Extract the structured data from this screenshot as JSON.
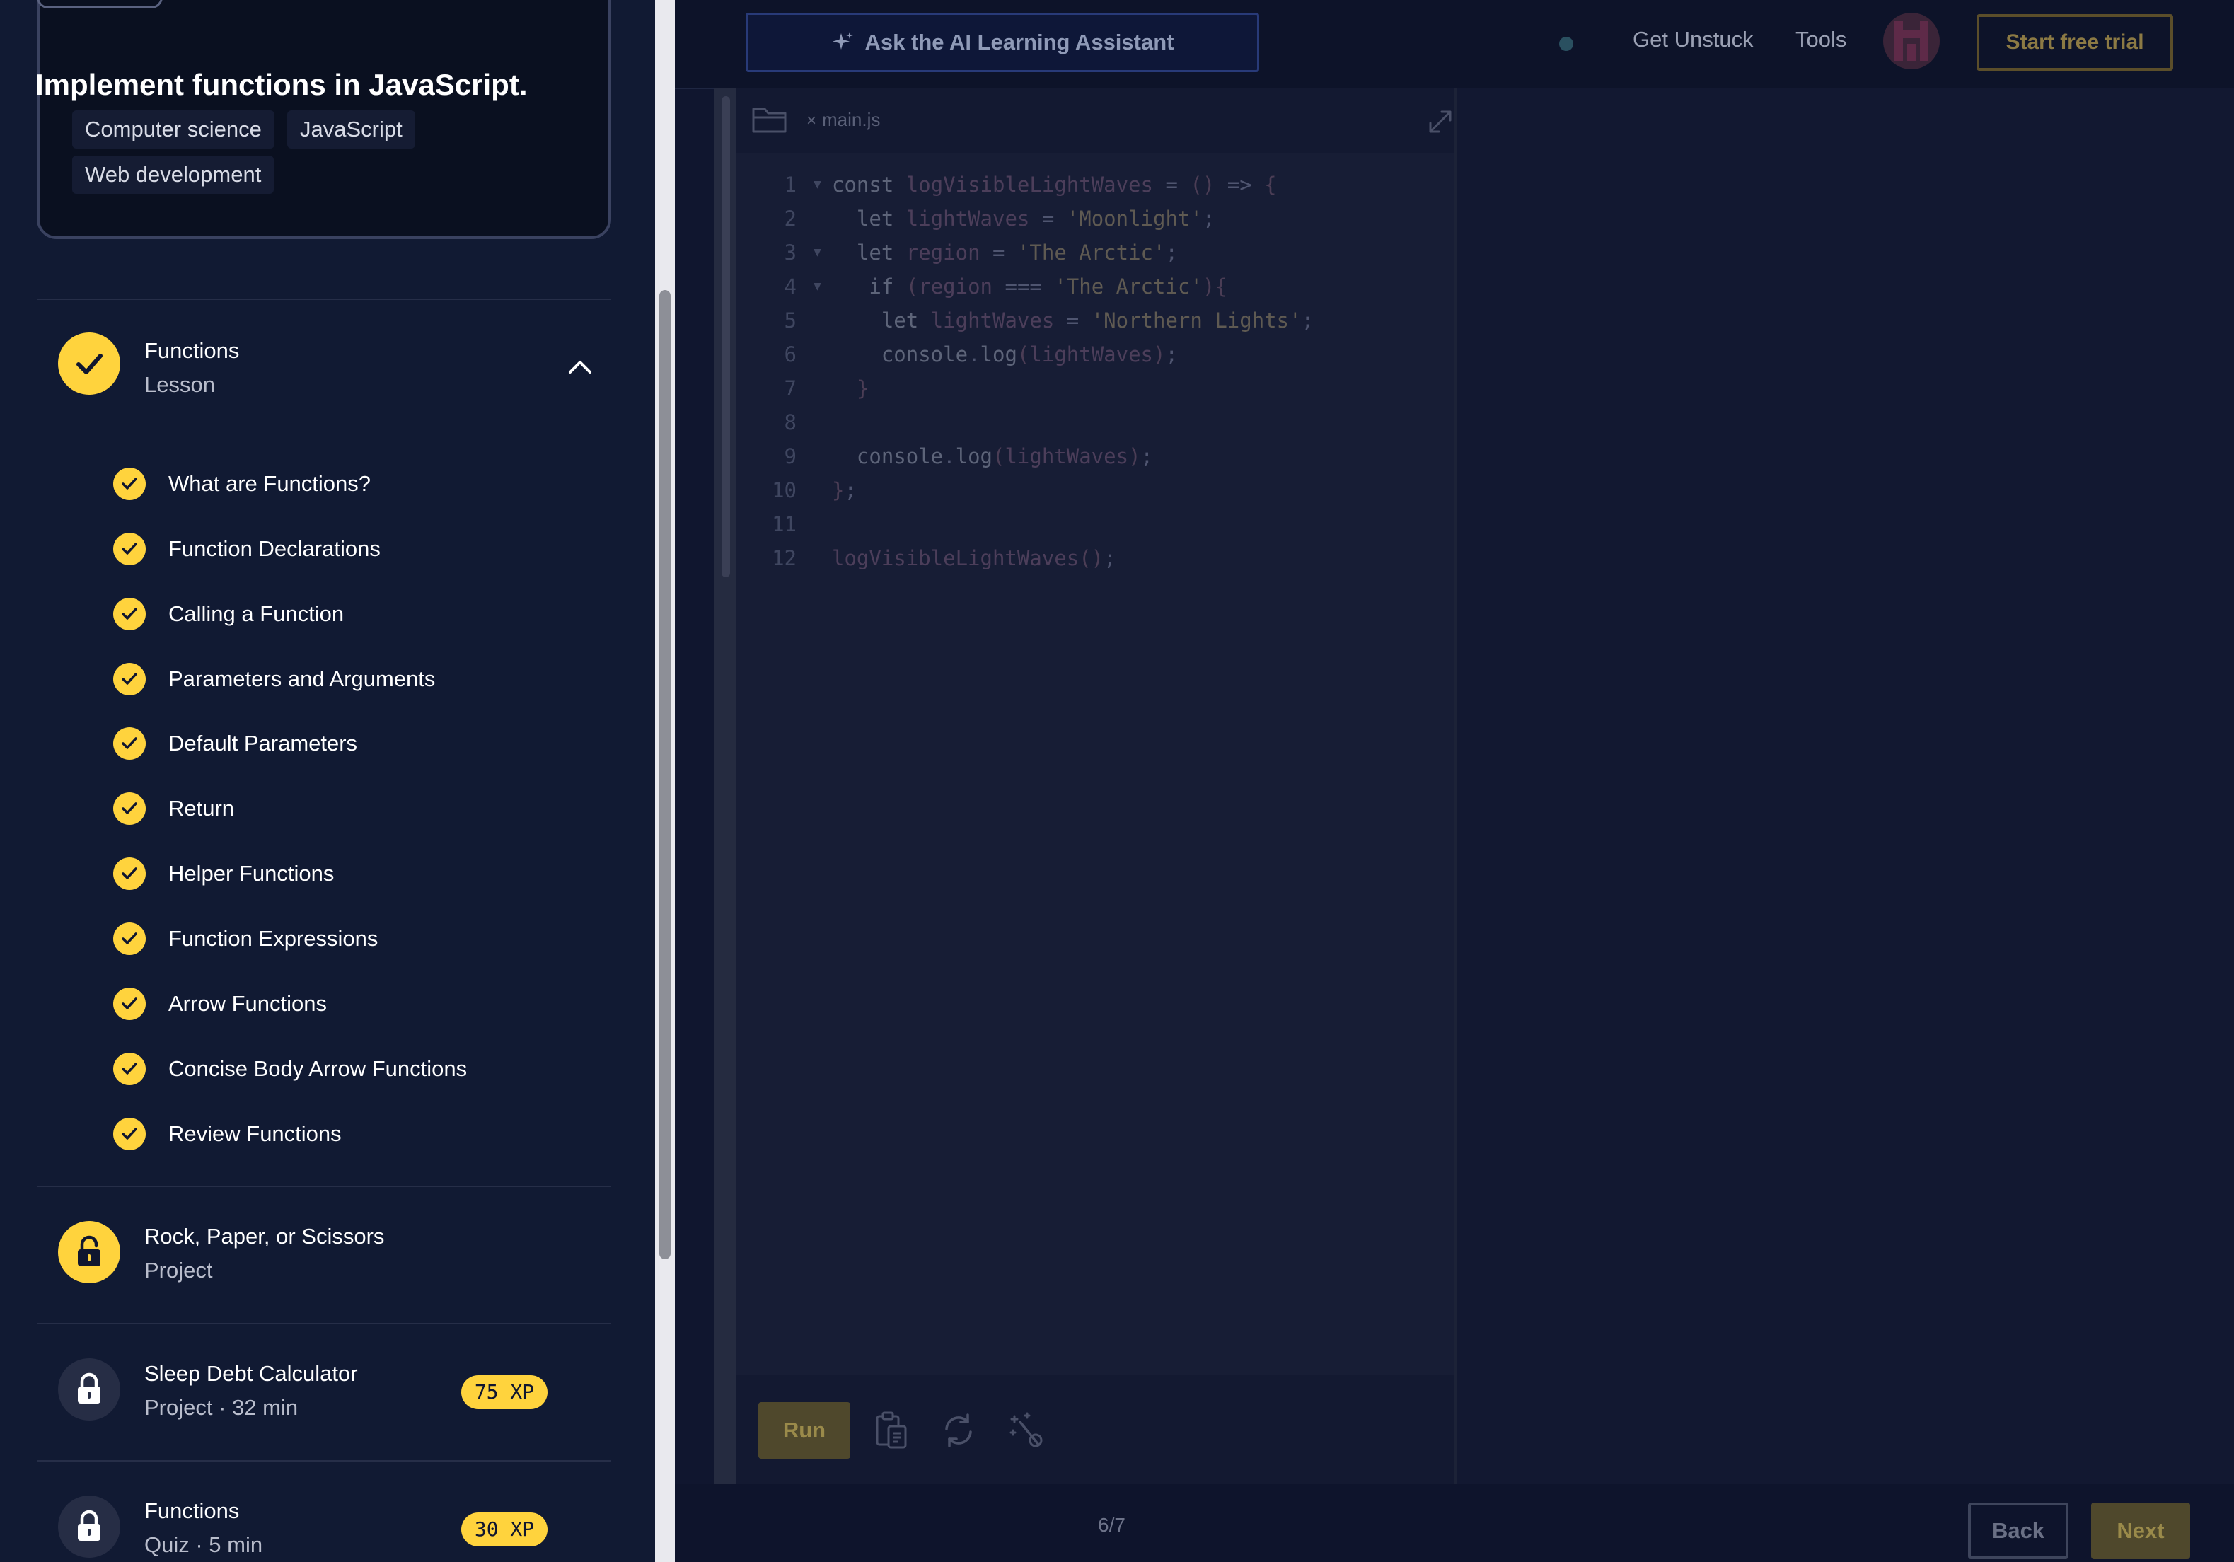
{
  "course": {
    "title": "Implement functions in JavaScript.",
    "tags": [
      "Computer science",
      "JavaScript",
      "Web development"
    ]
  },
  "modules": [
    {
      "title": "Functions",
      "subtitle": "Lesson",
      "status": "completed",
      "expanded": true,
      "lessons": [
        "What are Functions?",
        "Function Declarations",
        "Calling a Function",
        "Parameters and Arguments",
        "Default Parameters",
        "Return",
        "Helper Functions",
        "Function Expressions",
        "Arrow Functions",
        "Concise Body Arrow Functions",
        "Review Functions"
      ]
    },
    {
      "title": "Rock, Paper, or Scissors",
      "subtitle": "Project",
      "status": "unlocked"
    },
    {
      "title": "Sleep Debt Calculator",
      "subtitle": "Project · 32 min",
      "status": "locked",
      "xp": "75 XP"
    },
    {
      "title": "Functions",
      "subtitle": "Quiz · 5 min",
      "status": "locked",
      "xp": "30 XP"
    }
  ],
  "topbar": {
    "ai_button": "Ask the AI Learning Assistant",
    "get_unstuck": "Get Unstuck",
    "tools": "Tools",
    "trial_button": "Start free trial"
  },
  "editor": {
    "file_name": "main.js",
    "line_numbers": [
      "1",
      "2",
      "3",
      "4",
      "5",
      "6",
      "7",
      "8",
      "9",
      "10",
      "11",
      "12"
    ],
    "run_label": "Run"
  },
  "footer": {
    "page_indicator": "6/7",
    "back_label": "Back",
    "next_label": "Next"
  },
  "colors": {
    "accent_yellow": "#ffd33d",
    "background_navy": "#10162f"
  }
}
